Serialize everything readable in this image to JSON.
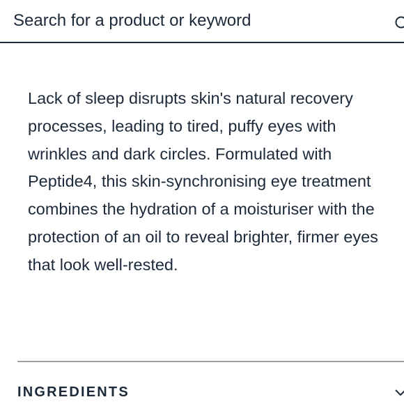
{
  "search": {
    "placeholder": "Search for a product or keyword",
    "icon": "search-icon"
  },
  "description": {
    "lines": [
      "Lack of sleep disrupts skin's natural recovery",
      "processes, leading to tired, puffy eyes with",
      "wrinkles and dark circles. Formulated with",
      "Peptide4, this skin-synchronising eye treatment",
      "combines the hydration of a moisturiser with the",
      "protection of an oil to reveal brighter, firmer eyes",
      "that look well-rested."
    ]
  },
  "accordion": {
    "title": "INGREDIENTS",
    "icon": "chevron-down-icon",
    "expanded": false
  },
  "colors": {
    "text": "#1c2a3a",
    "divider": "#9aa0a6",
    "background": "#ffffff"
  }
}
